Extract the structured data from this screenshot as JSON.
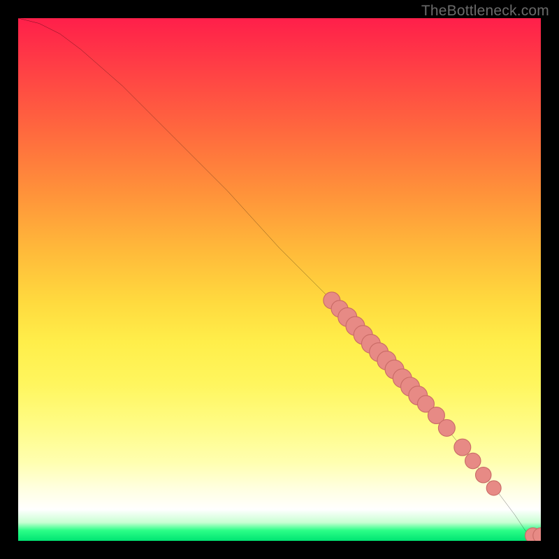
{
  "watermark": "TheBottleneck.com",
  "colors": {
    "background_frame": "#000000",
    "curve": "#000000",
    "marker_fill": "#e78a85",
    "marker_stroke": "#c96b66",
    "gradient_top": "#ff1f4a",
    "gradient_mid": "#ffee4a",
    "gradient_bottom_green": "#00e472"
  },
  "chart_data": {
    "type": "line",
    "title": "",
    "xlabel": "",
    "ylabel": "",
    "xlim": [
      0,
      100
    ],
    "ylim": [
      0,
      100
    ],
    "grid": false,
    "legend": null,
    "curve": {
      "name": "bottleneck-curve",
      "x": [
        0,
        4,
        8,
        12,
        20,
        30,
        40,
        50,
        60,
        70,
        80,
        88,
        92,
        95,
        97,
        98,
        100
      ],
      "y": [
        100,
        99,
        97,
        94,
        87,
        77,
        67,
        56,
        46,
        35,
        24,
        14,
        9,
        5,
        2,
        1,
        1
      ]
    },
    "markers": {
      "name": "highlighted-range",
      "points": [
        {
          "x": 60,
          "y": 46,
          "r": 1.6
        },
        {
          "x": 61.5,
          "y": 44.4,
          "r": 1.6
        },
        {
          "x": 63,
          "y": 42.8,
          "r": 1.8
        },
        {
          "x": 64.5,
          "y": 41.1,
          "r": 1.8
        },
        {
          "x": 66,
          "y": 39.4,
          "r": 1.8
        },
        {
          "x": 67.5,
          "y": 37.7,
          "r": 1.8
        },
        {
          "x": 69,
          "y": 36.1,
          "r": 1.8
        },
        {
          "x": 70.5,
          "y": 34.5,
          "r": 1.8
        },
        {
          "x": 72,
          "y": 32.8,
          "r": 1.8
        },
        {
          "x": 73.5,
          "y": 31.1,
          "r": 1.8
        },
        {
          "x": 75,
          "y": 29.5,
          "r": 1.8
        },
        {
          "x": 76.5,
          "y": 27.8,
          "r": 1.8
        },
        {
          "x": 78,
          "y": 26.2,
          "r": 1.6
        },
        {
          "x": 80,
          "y": 24.0,
          "r": 1.6
        },
        {
          "x": 82,
          "y": 21.6,
          "r": 1.6
        },
        {
          "x": 85,
          "y": 17.9,
          "r": 1.6
        },
        {
          "x": 87,
          "y": 15.3,
          "r": 1.5
        },
        {
          "x": 89,
          "y": 12.6,
          "r": 1.5
        },
        {
          "x": 91,
          "y": 10.1,
          "r": 1.4
        },
        {
          "x": 98.5,
          "y": 1.0,
          "r": 1.5
        },
        {
          "x": 100,
          "y": 1.0,
          "r": 1.5
        }
      ]
    }
  }
}
